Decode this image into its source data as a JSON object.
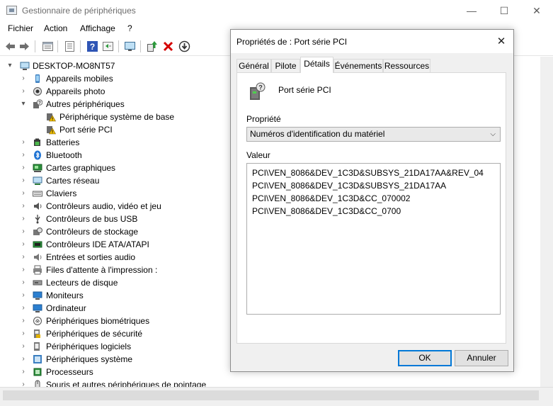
{
  "window": {
    "title": "Gestionnaire de périphériques",
    "minimize_glyph": "—",
    "maximize_glyph": "☐",
    "close_glyph": "✕"
  },
  "menu": [
    "Fichier",
    "Action",
    "Affichage",
    "?"
  ],
  "toolbar_icons": [
    "back-icon",
    "forward-icon",
    "properties-icon",
    "list-icon",
    "help-icon",
    "view-icon",
    "monitor-icon",
    "update-driver-icon",
    "uninstall-icon",
    "download-icon"
  ],
  "tree": {
    "root": "DESKTOP-MO8NT57",
    "items": [
      {
        "label": "Appareils mobiles",
        "icon": "mobile-device-icon",
        "level": 1,
        "expanded": false
      },
      {
        "label": "Appareils photo",
        "icon": "camera-icon",
        "level": 1,
        "expanded": false
      },
      {
        "label": "Autres périphériques",
        "icon": "unknown-device-icon",
        "level": 1,
        "expanded": true
      },
      {
        "label": "Périphérique système de base",
        "icon": "warning-device-icon",
        "level": 2
      },
      {
        "label": "Port série PCI",
        "icon": "warning-device-icon",
        "level": 2
      },
      {
        "label": "Batteries",
        "icon": "battery-icon",
        "level": 1,
        "expanded": false
      },
      {
        "label": "Bluetooth",
        "icon": "bluetooth-icon",
        "level": 1,
        "expanded": false
      },
      {
        "label": "Cartes graphiques",
        "icon": "display-adapter-icon",
        "level": 1,
        "expanded": false
      },
      {
        "label": "Cartes réseau",
        "icon": "network-adapter-icon",
        "level": 1,
        "expanded": false
      },
      {
        "label": "Claviers",
        "icon": "keyboard-icon",
        "level": 1,
        "expanded": false
      },
      {
        "label": "Contrôleurs audio, vidéo et jeu",
        "icon": "speaker-icon",
        "level": 1,
        "expanded": false
      },
      {
        "label": "Contrôleurs de bus USB",
        "icon": "usb-icon",
        "level": 1,
        "expanded": false
      },
      {
        "label": "Contrôleurs de stockage",
        "icon": "storage-controller-icon",
        "level": 1,
        "expanded": false
      },
      {
        "label": "Contrôleurs IDE ATA/ATAPI",
        "icon": "ide-controller-icon",
        "level": 1,
        "expanded": false
      },
      {
        "label": "Entrées et sorties audio",
        "icon": "audio-io-icon",
        "level": 1,
        "expanded": false
      },
      {
        "label": "Files d'attente à l'impression :",
        "icon": "printer-icon",
        "level": 1,
        "expanded": false
      },
      {
        "label": "Lecteurs de disque",
        "icon": "disk-drive-icon",
        "level": 1,
        "expanded": false
      },
      {
        "label": "Moniteurs",
        "icon": "monitor-icon",
        "level": 1,
        "expanded": false
      },
      {
        "label": "Ordinateur",
        "icon": "computer-icon",
        "level": 1,
        "expanded": false
      },
      {
        "label": "Périphériques biométriques",
        "icon": "fingerprint-icon",
        "level": 1,
        "expanded": false
      },
      {
        "label": "Périphériques de sécurité",
        "icon": "security-device-icon",
        "level": 1,
        "expanded": false
      },
      {
        "label": "Périphériques logiciels",
        "icon": "software-device-icon",
        "level": 1,
        "expanded": false
      },
      {
        "label": "Périphériques système",
        "icon": "system-device-icon",
        "level": 1,
        "expanded": false
      },
      {
        "label": "Processeurs",
        "icon": "processor-icon",
        "level": 1,
        "expanded": false
      },
      {
        "label": "Souris et autres périphériques de pointage",
        "icon": "mouse-icon",
        "level": 1,
        "expanded": false
      }
    ]
  },
  "dialog": {
    "title": "Propriétés de : Port série PCI",
    "close_glyph": "✕",
    "tabs": [
      "Général",
      "Pilote",
      "Détails",
      "Événements",
      "Ressources"
    ],
    "active_tab": "Détails",
    "device_name": "Port série PCI",
    "property_label": "Propriété",
    "property_value": "Numéros d'identification du matériel",
    "value_label": "Valeur",
    "values": [
      "PCI\\VEN_8086&DEV_1C3D&SUBSYS_21DA17AA&REV_04",
      "PCI\\VEN_8086&DEV_1C3D&SUBSYS_21DA17AA",
      "PCI\\VEN_8086&DEV_1C3D&CC_070002",
      "PCI\\VEN_8086&DEV_1C3D&CC_0700"
    ],
    "ok_label": "OK",
    "cancel_label": "Annuler"
  },
  "colors": {
    "accent": "#0078d7",
    "warning": "#f2c200",
    "error_red": "#d40000",
    "folder_blue": "#3c7fc1"
  }
}
